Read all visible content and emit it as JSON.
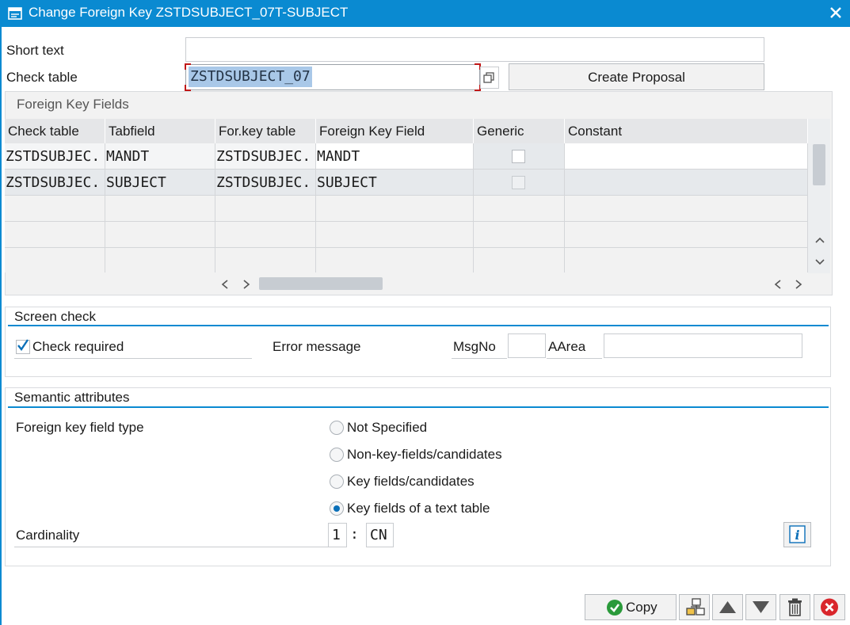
{
  "window": {
    "title": "Change Foreign Key ZSTDSUBJECT_07T-SUBJECT"
  },
  "header": {
    "short_text_label": "Short text",
    "short_text_value": "",
    "check_table_label": "Check table",
    "check_table_value": "ZSTDSUBJECT_07",
    "create_proposal_label": "Create Proposal"
  },
  "fk_fields": {
    "title": "Foreign Key Fields",
    "columns": [
      "Check table",
      "Tabfield",
      "For.key table",
      "Foreign Key Field",
      "Generic",
      "Constant"
    ],
    "rows": [
      {
        "check_table": "ZSTDSUBJEC.",
        "tabfield": "MANDT",
        "forkey_table": "ZSTDSUBJEC.",
        "fk_field": "MANDT",
        "generic": false,
        "constant": ""
      },
      {
        "check_table": "ZSTDSUBJEC.",
        "tabfield": "SUBJECT",
        "forkey_table": "ZSTDSUBJEC.",
        "fk_field": "SUBJECT",
        "generic": false,
        "constant": ""
      }
    ]
  },
  "screen_check": {
    "title": "Screen check",
    "check_required_label": "Check required",
    "check_required": true,
    "error_message_label": "Error message",
    "msgno_label": "MsgNo",
    "msgno_value": "",
    "aarea_label": "AArea",
    "aarea_value": ""
  },
  "semantic": {
    "title": "Semantic attributes",
    "fk_field_type_label": "Foreign key field type",
    "options": [
      {
        "label": "Not Specified",
        "selected": false
      },
      {
        "label": "Non-key-fields/candidates",
        "selected": false
      },
      {
        "label": "Key fields/candidates",
        "selected": false
      },
      {
        "label": "Key fields of a text table",
        "selected": true
      }
    ],
    "cardinality_label": "Cardinality",
    "card_left": "1",
    "card_sep": ":",
    "card_right": "CN"
  },
  "footer": {
    "copy_label": "Copy"
  },
  "colors": {
    "accent": "#0a8ad1",
    "selection": "#a9c8e8",
    "focus_corner": "#c01818",
    "delete_red": "#d9262c",
    "ok_green": "#2a9a3a"
  }
}
